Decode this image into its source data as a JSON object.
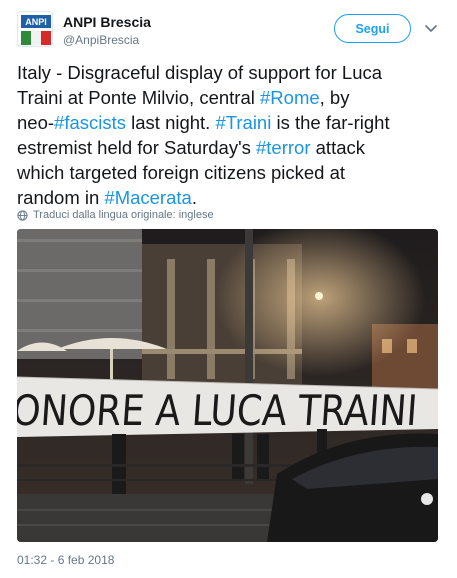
{
  "account": {
    "display_name": "ANPI Brescia",
    "handle": "@AnpiBrescia",
    "avatar_text": "ANPI"
  },
  "follow_button": {
    "label": "Segui"
  },
  "tweet": {
    "lines": [
      [
        {
          "t": "Italy - Disgraceful display of support for Luca"
        }
      ],
      [
        {
          "t": "Traini at Ponte Milvio, central "
        },
        {
          "t": "#Rome",
          "tag": true
        },
        {
          "t": ", by"
        }
      ],
      [
        {
          "t": "neo-"
        },
        {
          "t": "#fascists",
          "tag": true
        },
        {
          "t": " last night. "
        },
        {
          "t": "#Traini",
          "tag": true
        },
        {
          "t": " is the far-right"
        }
      ],
      [
        {
          "t": "estremist held for Saturday's "
        },
        {
          "t": "#terror",
          "tag": true
        },
        {
          "t": " attack"
        }
      ],
      [
        {
          "t": "which targeted foreign citizens picked at"
        }
      ],
      [
        {
          "t": "random in "
        },
        {
          "t": "#Macerata",
          "tag": true
        },
        {
          "t": "."
        }
      ]
    ]
  },
  "translation_note": "Traduci dalla lingua originale: inglese",
  "media": {
    "banner_text": "ONORE A LUCA TRAINI"
  },
  "timestamp": "01:32 - 6 feb 2018",
  "colors": {
    "accent": "#1da1f2",
    "hashtag": "#1b95e0",
    "secondary_text": "#657786"
  }
}
